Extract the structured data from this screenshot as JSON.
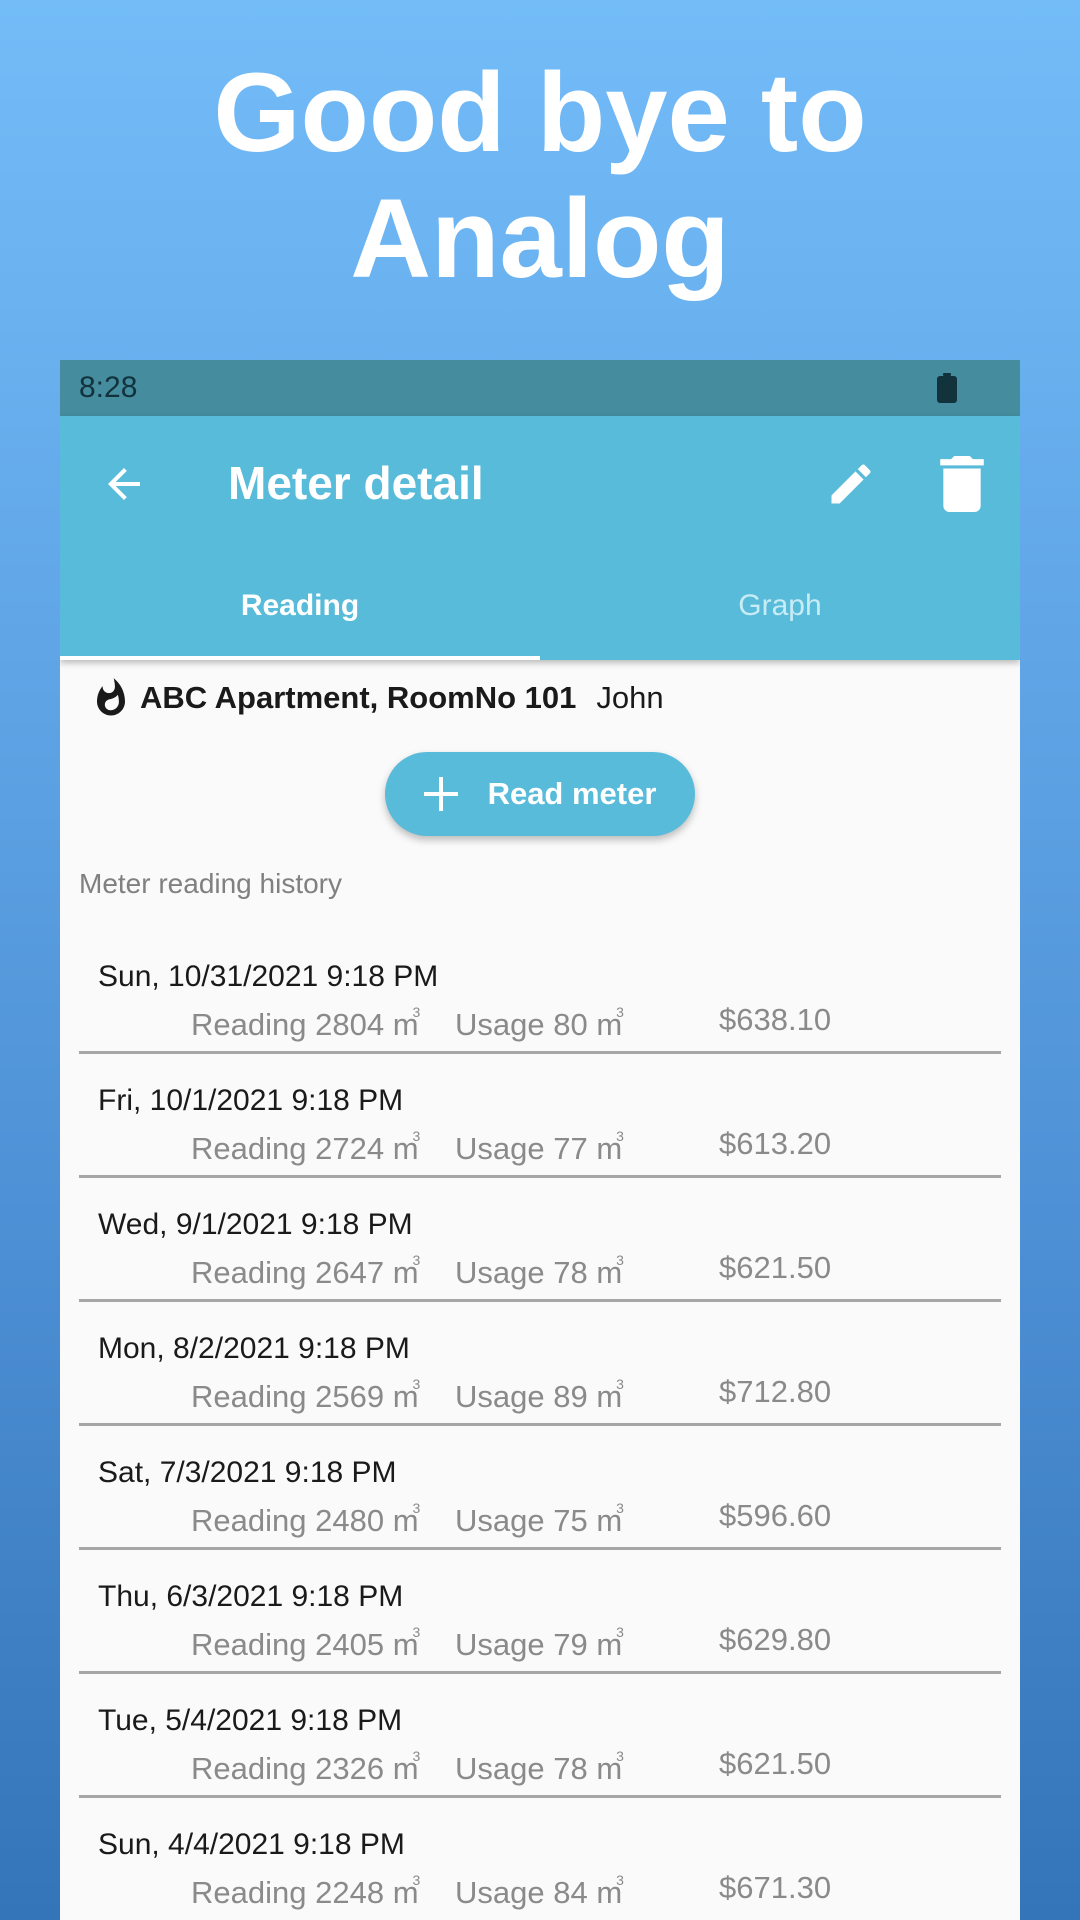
{
  "promo": {
    "headline_line1": "Good bye to",
    "headline_line2": "Analog"
  },
  "status_bar": {
    "time": "8:28",
    "battery_icon": "battery-full-icon"
  },
  "app_bar": {
    "back_icon": "arrow-left-icon",
    "title": "Meter detail",
    "edit_icon": "pencil-icon",
    "delete_icon": "trash-icon",
    "color": "#58bbd9"
  },
  "tabs": [
    {
      "label": "Reading",
      "active": true
    },
    {
      "label": "Graph",
      "active": false
    }
  ],
  "meter": {
    "type_icon": "flame-icon",
    "name": "ABC Apartment, RoomNo 101",
    "owner": "John"
  },
  "read_button": {
    "icon": "plus-icon",
    "label": "Read meter"
  },
  "history": {
    "title": "Meter reading history",
    "unit": "m",
    "unit_sup": "3",
    "reading_prefix": "Reading",
    "usage_prefix": "Usage",
    "items": [
      {
        "date": "Sun, 10/31/2021 9:18 PM",
        "reading": "2804",
        "usage": "80",
        "cost": "$638.10"
      },
      {
        "date": "Fri, 10/1/2021 9:18 PM",
        "reading": "2724",
        "usage": "77",
        "cost": "$613.20"
      },
      {
        "date": "Wed, 9/1/2021 9:18 PM",
        "reading": "2647",
        "usage": "78",
        "cost": "$621.50"
      },
      {
        "date": "Mon, 8/2/2021 9:18 PM",
        "reading": "2569",
        "usage": "89",
        "cost": "$712.80"
      },
      {
        "date": "Sat, 7/3/2021 9:18 PM",
        "reading": "2480",
        "usage": "75",
        "cost": "$596.60"
      },
      {
        "date": "Thu, 6/3/2021 9:18 PM",
        "reading": "2405",
        "usage": "79",
        "cost": "$629.80"
      },
      {
        "date": "Tue, 5/4/2021 9:18 PM",
        "reading": "2326",
        "usage": "78",
        "cost": "$621.50"
      },
      {
        "date": "Sun, 4/4/2021 9:18 PM",
        "reading": "2248",
        "usage": "84",
        "cost": "$671.30"
      }
    ]
  }
}
